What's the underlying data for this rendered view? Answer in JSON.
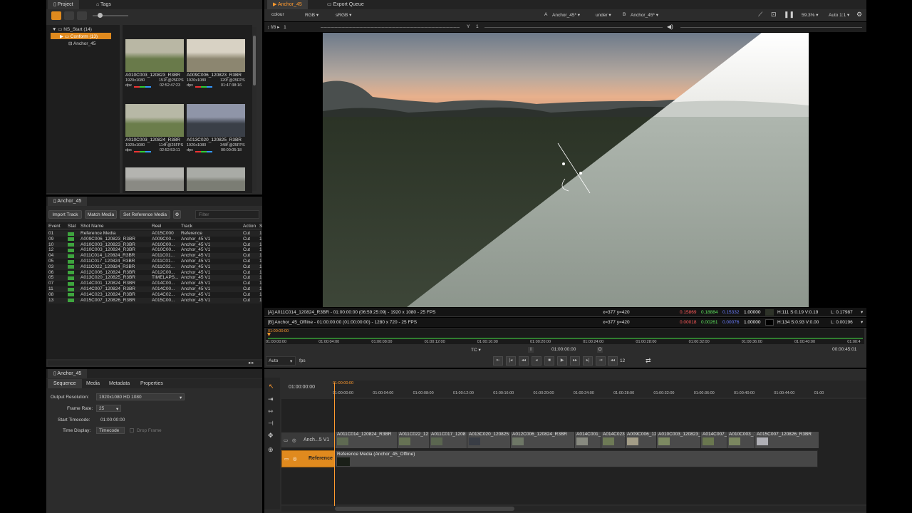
{
  "project": {
    "tabs": [
      "Project",
      "Tags"
    ],
    "tree": {
      "root": "NS_Start (14)",
      "folder": "Conform (13)",
      "item": "Anchor_45"
    }
  },
  "thumbs": [
    {
      "name": "A010C003_120823_R3BR",
      "res": "1920x1080",
      "fps": "151f @25FPS",
      "fmt": "dpx",
      "tc": "02:52:47:23",
      "sky": "#b9b7a4",
      "ground": "#697a4a"
    },
    {
      "name": "A009C006_120823_R3BR",
      "res": "1920x1080",
      "fps": "120f @25FPS",
      "fmt": "dpx",
      "tc": "01:47:38:16",
      "sky": "#d8d2c4",
      "ground": "#8c8670"
    },
    {
      "name": "A010C003_120824_R3BR",
      "res": "1920x1080",
      "fps": "114f @25FPS",
      "fmt": "dpx",
      "tc": "02:52:53:11",
      "sky": "#b7b8a6",
      "ground": "#6b7d4b"
    },
    {
      "name": "A013C020_120825_R3BR",
      "res": "1920x1080",
      "fps": "348f @25FPS",
      "fmt": "dpx",
      "tc": "00:00:05:18",
      "sky": "#8f95a8",
      "ground": "#3a3f47"
    },
    {
      "name": "",
      "res": "",
      "fps": "",
      "fmt": "",
      "tc": "",
      "sky": "#b4b4b0",
      "ground": "#8a8a84"
    },
    {
      "name": "",
      "res": "",
      "fps": "",
      "fmt": "",
      "tc": "",
      "sky": "#a9aba6",
      "ground": "#7b7d74"
    }
  ],
  "events": {
    "tab": "Anchor_45",
    "buttons": {
      "import": "Import Track",
      "match": "Match Media",
      "set_ref": "Set Reference Media"
    },
    "filter_placeholder": "Filter",
    "headers": {
      "event": "Event",
      "stat": "Stat",
      "shot": "Shot Name",
      "reel": "Reel",
      "track": "Track",
      "action": "Action",
      "s": "S"
    },
    "rows": [
      {
        "event": "01",
        "shot": "Reference Media",
        "reel": "A015C000",
        "track": "Reference",
        "action": "Cut",
        "s": "1"
      },
      {
        "event": "09",
        "shot": "A009C006_120823_R3BR",
        "reel": "A009C00...",
        "track": "Anchor_45 V1",
        "action": "Cut",
        "s": "1"
      },
      {
        "event": "10",
        "shot": "A010C003_120823_R3BR",
        "reel": "A010C00...",
        "track": "Anchor_45 V1",
        "action": "Cut",
        "s": "1"
      },
      {
        "event": "12",
        "shot": "A010C003_120824_R3BR",
        "reel": "A010C00...",
        "track": "Anchor_45 V1",
        "action": "Cut",
        "s": "1"
      },
      {
        "event": "04",
        "shot": "A011C014_120824_R3BR",
        "reel": "A011C01...",
        "track": "Anchor_45 V1",
        "action": "Cut",
        "s": "1"
      },
      {
        "event": "05",
        "shot": "A011C017_120824_R3BR",
        "reel": "A011C01...",
        "track": "Anchor_45 V1",
        "action": "Cut",
        "s": "1"
      },
      {
        "event": "03",
        "shot": "A011C022_120824_R3BR",
        "reel": "A011C02...",
        "track": "Anchor_45 V1",
        "action": "Cut",
        "s": "1"
      },
      {
        "event": "06",
        "shot": "A012C006_120824_R3BR",
        "reel": "A012C00...",
        "track": "Anchor_45 V1",
        "action": "Cut",
        "s": "1"
      },
      {
        "event": "05",
        "shot": "A013C020_120825_R3BR",
        "reel": "TIMELAPS...",
        "track": "Anchor_45 V1",
        "action": "Cut",
        "s": "1"
      },
      {
        "event": "07",
        "shot": "A014C001_120824_R3BR",
        "reel": "A014C00...",
        "track": "Anchor_45 V1",
        "action": "Cut",
        "s": "1"
      },
      {
        "event": "11",
        "shot": "A014C007_120824_R3BR",
        "reel": "A014C00...",
        "track": "Anchor_45 V1",
        "action": "Cut",
        "s": "1"
      },
      {
        "event": "08",
        "shot": "A014C023_120824_R3BR",
        "reel": "A014C02...",
        "track": "Anchor_45 V1",
        "action": "Cut",
        "s": "1"
      },
      {
        "event": "13",
        "shot": "A015C007_120826_R3BR",
        "reel": "A015C00...",
        "track": "Anchor_45 V1",
        "action": "Cut",
        "s": "1"
      }
    ]
  },
  "viewer": {
    "tabs": [
      "Anchor_45",
      "Export Queue"
    ],
    "colour": "colour",
    "rgb": "RGB",
    "srgb": "sRGB",
    "a_label": "A",
    "a_value": "Anchor_45*",
    "mode": "under",
    "b_label": "B",
    "b_value": "Anchor_45*",
    "zoom": "59.3%",
    "auto": "Auto 1:1",
    "fstop": "f/8",
    "x_val": "1",
    "y_label": "Y",
    "y_val": "1",
    "info_a": "[A] A011C014_120824_R3BR - 01:00:00:00 (06:59:25:09) - 1920 x 1080 - 25 FPS",
    "info_a_xy": "x=377 y=420",
    "info_a_r": "0.15869",
    "info_a_g": "0.18884",
    "info_a_b": "0.15332",
    "info_a_a": "1.00000",
    "info_a_hsv": "H:111 S:0.19 V:0.19",
    "info_a_l": "L: 0.17987",
    "info_b": "[B] Anchor_45_Offline - 01:00:00:00 (01:00:00:00) - 1280 x 720 - 25 FPS",
    "info_b_xy": "x=377 y=420",
    "info_b_r": "0.00018",
    "info_b_g": "0.00261",
    "info_b_b": "0.00076",
    "info_b_a": "1.00000",
    "info_b_hsv": "H:134 S:0.93 V:0.00",
    "info_b_l": "L: 0.00196"
  },
  "transport": {
    "playhead": "01:00:00:00",
    "ruler": [
      "01:00:00:00",
      "01:00:04:00",
      "01:00:08:00",
      "01:00:12:00",
      "01:00:16:00",
      "01:00:20:00",
      "01:00:24:00",
      "01:00:28:00",
      "01:00:32:00",
      "01:00:36:00",
      "01:00:40:00",
      "01:00:4"
    ],
    "tc_label": "TC",
    "timecode": "01:00:00:00",
    "duration": "00:00:45:01",
    "fps_select": "Auto",
    "fps_label": "fps",
    "step": "12"
  },
  "inspector": {
    "tab": "Anchor_45",
    "subtabs": [
      "Sequence",
      "Media",
      "Metadata",
      "Properties"
    ],
    "output_label": "Output Resolution:",
    "output_value": "1920x1080 HD 1080",
    "framerate_label": "Frame Rate:",
    "framerate_value": "25",
    "start_label": "Start Timecode:",
    "start_value": "01:00:00:00",
    "display_label": "Time Display:",
    "display_value": "Timecode",
    "dropframe": "Drop Frame"
  },
  "timeline": {
    "tc": "01:00:00:00",
    "playhead": "01:00:00:00",
    "ruler": [
      "01:00:00:00",
      "01:00:04:00",
      "01:00:08:00",
      "01:00:12:00",
      "01:00:16:00",
      "01:00:20:00",
      "01:00:24:00",
      "01:00:28:00",
      "01:00:32:00",
      "01:00:36:00",
      "01:00:40:00",
      "01:00:44:00",
      "01:00"
    ],
    "track_v1": "Anch...5 V1",
    "track_ref": "Reference",
    "clips": [
      {
        "label": "A011C014_120824_R3BR",
        "color": "#5f6a52"
      },
      {
        "label": "A011C022_12",
        "color": "#667254"
      },
      {
        "label": "A011C017_1208",
        "color": "#5b6650"
      },
      {
        "label": "A013C020_120825",
        "color": "#393d45"
      },
      {
        "label": "A012C006_120824_R3BR",
        "color": "#6e7766"
      },
      {
        "label": "A014C001_",
        "color": "#888a80"
      },
      {
        "label": "A014C023_",
        "color": "#6e7a56"
      },
      {
        "label": "A009C006_12",
        "color": "#a39d87"
      },
      {
        "label": "A010C003_120823_",
        "color": "#7d8a62"
      },
      {
        "label": "A014C007_",
        "color": "#6a774f"
      },
      {
        "label": "A010C003_1",
        "color": "#7b8760"
      },
      {
        "label": "A015C007_120826_R3BR",
        "color": "#b0b0b6"
      }
    ],
    "ref_clip": "Reference Media (Anchor_45_Offline)"
  }
}
